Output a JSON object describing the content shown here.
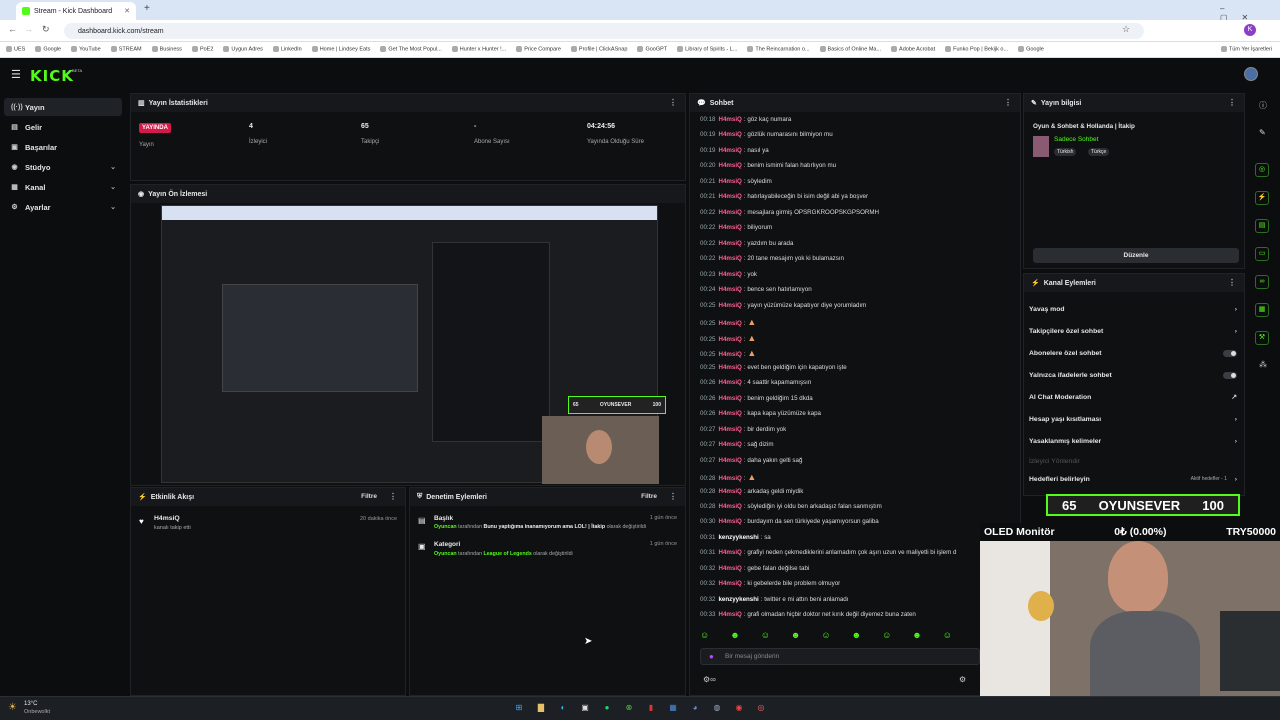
{
  "browser": {
    "tab_title": "Stream - Kick Dashboard",
    "url": "dashboard.kick.com/stream",
    "bookmarks": [
      "UES",
      "Google",
      "YouTube",
      "STREAM",
      "Business",
      "PoE2",
      "Uygun Adres",
      "LinkedIn",
      "Home | Lindsey Eats",
      "Get The Most Popul...",
      "Hunter x Hunter !...",
      "Price Compare",
      "Profile | ClickASnap",
      "GooGPT",
      "Library of Spirits - L...",
      "The Reincarnation o...",
      "Basics of Online Ma...",
      "Adobe Acrobat",
      "Funko Pop | Bekijk o...",
      "Google",
      "Tüm Yer İşaretleri"
    ]
  },
  "kick": {
    "logo": "KICK",
    "beta": "BETA"
  },
  "sidebar": {
    "items": [
      {
        "label": "Yayın"
      },
      {
        "label": "Gelir"
      },
      {
        "label": "Başarılar"
      },
      {
        "label": "Stüdyo"
      },
      {
        "label": "Kanal"
      },
      {
        "label": "Ayarlar"
      }
    ]
  },
  "stats": {
    "title": "Yayın İstatistikleri",
    "live_badge": "YAYINDA",
    "items": [
      {
        "value": "",
        "label": "Yayın"
      },
      {
        "value": "4",
        "label": "İzleyici"
      },
      {
        "value": "65",
        "label": "Takipçi"
      },
      {
        "value": "-",
        "label": "Abone Sayısı"
      },
      {
        "value": "04:24:56",
        "label": "Yayında Olduğu Süre"
      }
    ]
  },
  "preview": {
    "title": "Yayın Ön İzlemesi",
    "overlay_left": "65",
    "overlay_mid": "OYUNSEVER",
    "overlay_right": "100"
  },
  "activity": {
    "title": "Etkinlik Akışı",
    "filter": "Filtre",
    "user": "H4msiQ",
    "text": "kanalı takip etti",
    "time": "20 dakika önce"
  },
  "moderation": {
    "title": "Denetim Eylemleri",
    "filter": "Filtre",
    "items": [
      {
        "title": "Başlık",
        "who": "Oyuncan",
        "pre": "tarafından",
        "value": "Bunu yaptığıma inanamıyorum ama LOL! | İtakip",
        "post": "olarak değiştirildi",
        "time": "1 gün önce"
      },
      {
        "title": "Kategori",
        "who": "Oyuncan",
        "pre": "tarafından",
        "value": "League of Legends",
        "post": "olarak değiştirildi",
        "time": "1 gün önce"
      }
    ]
  },
  "chat": {
    "title": "Sohbet",
    "placeholder": "Bir mesaj gönderin",
    "messages": [
      {
        "t": "00:18",
        "u": "H4msiQ",
        "m": "göz kaç numara"
      },
      {
        "t": "00:19",
        "u": "H4msiQ",
        "m": "gözlük numarasını bilmiyon mu"
      },
      {
        "t": "00:19",
        "u": "H4msiQ",
        "m": "nasıl ya"
      },
      {
        "t": "00:20",
        "u": "H4msiQ",
        "m": "benim ismimi falan hatırlıyon mu"
      },
      {
        "t": "00:21",
        "u": "H4msiQ",
        "m": "söyledim"
      },
      {
        "t": "00:21",
        "u": "H4msiQ",
        "m": "hatırlayabileceğin bi isim değil abi ya boşver"
      },
      {
        "t": "00:22",
        "u": "H4msiQ",
        "m": "mesajlara girmiş OPSRGKROOPSKGPSORMH"
      },
      {
        "t": "00:22",
        "u": "H4msiQ",
        "m": "biliyorum"
      },
      {
        "t": "00:22",
        "u": "H4msiQ",
        "m": "yazdım bu arada"
      },
      {
        "t": "00:22",
        "u": "H4msiQ",
        "m": "20 tane mesajım yok ki bulamazsın"
      },
      {
        "t": "00:23",
        "u": "H4msiQ",
        "m": "yok"
      },
      {
        "t": "00:24",
        "u": "H4msiQ",
        "m": "bence sen hatırlamıyon"
      },
      {
        "t": "00:25",
        "u": "H4msiQ",
        "m": "yayın yüzümüze kapatıyor diye yorumladım"
      },
      {
        "t": "00:25",
        "u": "H4msiQ",
        "m": ""
      },
      {
        "t": "00:25",
        "u": "H4msiQ",
        "m": ""
      },
      {
        "t": "00:25",
        "u": "H4msiQ",
        "m": ""
      },
      {
        "t": "00:25",
        "u": "H4msiQ",
        "m": "evet ben geldiğim için kapatıyon işte"
      },
      {
        "t": "00:26",
        "u": "H4msiQ",
        "m": "4 saattir kapamamışsın"
      },
      {
        "t": "00:26",
        "u": "H4msiQ",
        "m": "benim geldiğim 15 dkda"
      },
      {
        "t": "00:26",
        "u": "H4msiQ",
        "m": "kapa kapa yüzümüze kapa"
      },
      {
        "t": "00:27",
        "u": "H4msiQ",
        "m": "bir derdim yok"
      },
      {
        "t": "00:27",
        "u": "H4msiQ",
        "m": "sağ dizim"
      },
      {
        "t": "00:27",
        "u": "H4msiQ",
        "m": "daha yakın gelti sağ"
      },
      {
        "t": "00:28",
        "u": "H4msiQ",
        "m": ""
      },
      {
        "t": "00:28",
        "u": "H4msiQ",
        "m": "arkadaş geldi miydik"
      },
      {
        "t": "00:28",
        "u": "H4msiQ",
        "m": "söylediğin iyi oldu ben arkadaşız falan sanmıştım"
      },
      {
        "t": "00:30",
        "u": "H4msiQ",
        "m": "burdayım da sen türkiyede yaşamıyorsun galiba"
      },
      {
        "t": "00:31",
        "u": "kenzyykenshi",
        "m": "sa"
      },
      {
        "t": "00:31",
        "u": "H4msiQ",
        "m": "grafiyi neden çekmediklerini anlamadım çok aşırı uzun ve maliyetli bi işlem d"
      },
      {
        "t": "00:32",
        "u": "H4msiQ",
        "m": "gebe falan değilse tabi"
      },
      {
        "t": "00:32",
        "u": "H4msiQ",
        "m": "ki gebelerde bile problem olmuyor"
      },
      {
        "t": "00:32",
        "u": "kenzyykenshi",
        "m": "twitter e mi attın beni anlamadı"
      },
      {
        "t": "00:33",
        "u": "H4msiQ",
        "m": "grafi olmadan hiçbir doktor net kırık değil diyemez buna zaten"
      }
    ]
  },
  "info": {
    "title": "Yayın bilgisi",
    "stream_title": "Oyun & Sohbet & Hollanda | İtakip",
    "category": "Sadece Sohbet",
    "tags": [
      "Türkish",
      "Türkçe"
    ],
    "edit": "Düzenle"
  },
  "actions": {
    "title": "Kanal Eylemleri",
    "items": [
      {
        "label": "Yavaş mod",
        "kind": "arrow"
      },
      {
        "label": "Takipçilere özel sohbet",
        "kind": "arrow"
      },
      {
        "label": "Abonelere özel sohbet",
        "kind": "toggle"
      },
      {
        "label": "Yalnızca ifadelerle sohbet",
        "kind": "toggle"
      },
      {
        "label": "AI Chat Moderation",
        "kind": "ext"
      },
      {
        "label": "Hesap yaşı kısıtlaması",
        "kind": "arrow"
      },
      {
        "label": "Yasaklanmış kelimeler",
        "kind": "arrow"
      },
      {
        "label": "İzleyici Yönlendir",
        "kind": "dim"
      },
      {
        "label": "Hedefleri belirleyin",
        "kind": "arrow"
      }
    ],
    "goal_badge": "Aktif hedefler - 1"
  },
  "overlay": {
    "goal_left": "65",
    "goal_mid": "OYUNSEVER",
    "goal_right": "100",
    "ticker_name": "OLED Monitör",
    "ticker_change": "0₺ (0.00%)",
    "ticker_price": "TRY50000"
  },
  "taskbar": {
    "temp": "13°C",
    "weather": "Onbewolkt"
  },
  "colors": {
    "accent": "#53fc18",
    "live": "#d31a48",
    "username": "#ff5f8f"
  }
}
